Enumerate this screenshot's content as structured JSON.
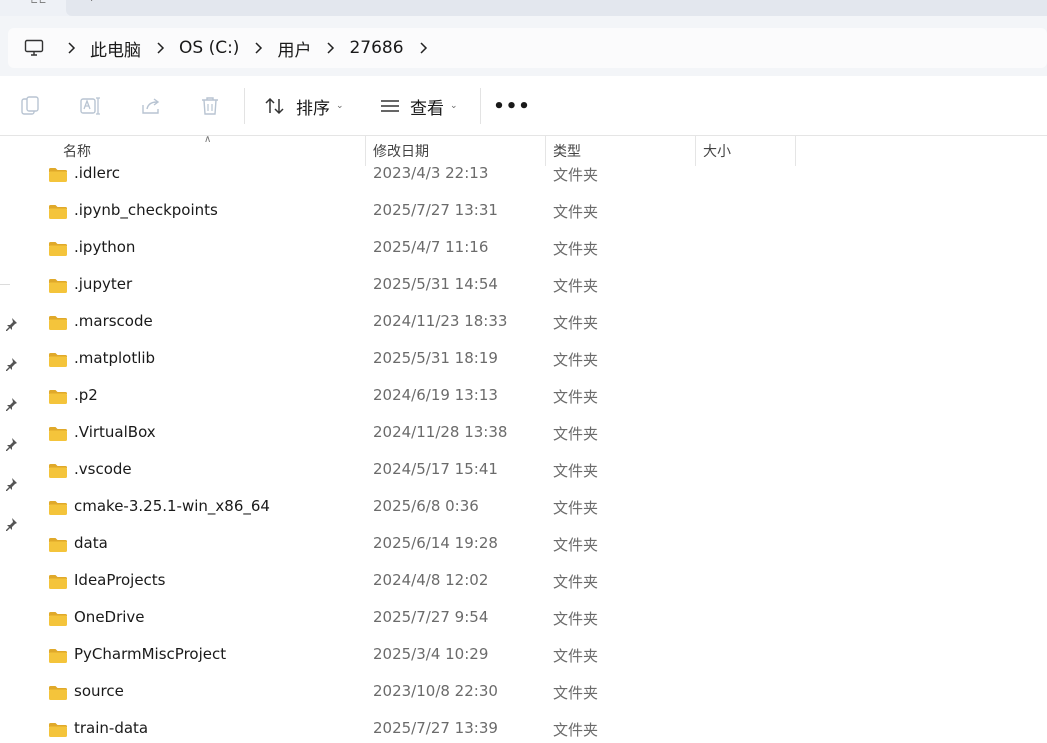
{
  "tabs": {
    "left_glyph": "∟∟",
    "right_glyph": "·"
  },
  "breadcrumbs": [
    "此电脑",
    "OS (C:)",
    "用户",
    "27686"
  ],
  "toolbar": {
    "copy_icon": "copy-icon",
    "rename_icon": "rename-icon",
    "share_icon": "share-icon",
    "delete_icon": "delete-icon",
    "sort_label": "排序",
    "view_label": "查看",
    "more_label": "•••"
  },
  "columns": {
    "name": "名称",
    "date": "修改日期",
    "type": "类型",
    "size": "大小",
    "sort_indicator": "∧"
  },
  "files": [
    {
      "name": ".idlerc",
      "date": "2023/4/3 22:13",
      "type": "文件夹"
    },
    {
      "name": ".ipynb_checkpoints",
      "date": "2025/7/27 13:31",
      "type": "文件夹"
    },
    {
      "name": ".ipython",
      "date": "2025/4/7 11:16",
      "type": "文件夹"
    },
    {
      "name": ".jupyter",
      "date": "2025/5/31 14:54",
      "type": "文件夹"
    },
    {
      "name": ".marscode",
      "date": "2024/11/23 18:33",
      "type": "文件夹"
    },
    {
      "name": ".matplotlib",
      "date": "2025/5/31 18:19",
      "type": "文件夹"
    },
    {
      "name": ".p2",
      "date": "2024/6/19 13:13",
      "type": "文件夹"
    },
    {
      "name": ".VirtualBox",
      "date": "2024/11/28 13:38",
      "type": "文件夹"
    },
    {
      "name": ".vscode",
      "date": "2024/5/17 15:41",
      "type": "文件夹"
    },
    {
      "name": "cmake-3.25.1-win_x86_64",
      "date": "2025/6/8 0:36",
      "type": "文件夹"
    },
    {
      "name": "data",
      "date": "2025/6/14 19:28",
      "type": "文件夹"
    },
    {
      "name": "IdeaProjects",
      "date": "2024/4/8 12:02",
      "type": "文件夹"
    },
    {
      "name": "OneDrive",
      "date": "2025/7/27 9:54",
      "type": "文件夹"
    },
    {
      "name": "PyCharmMiscProject",
      "date": "2025/3/4 10:29",
      "type": "文件夹"
    },
    {
      "name": "source",
      "date": "2023/10/8 22:30",
      "type": "文件夹"
    },
    {
      "name": "train-data",
      "date": "2025/7/27 13:39",
      "type": "文件夹"
    }
  ],
  "colors": {
    "folder": "#f4c43b",
    "folder_dark": "#e0a92a",
    "accent": "#0067c0"
  }
}
